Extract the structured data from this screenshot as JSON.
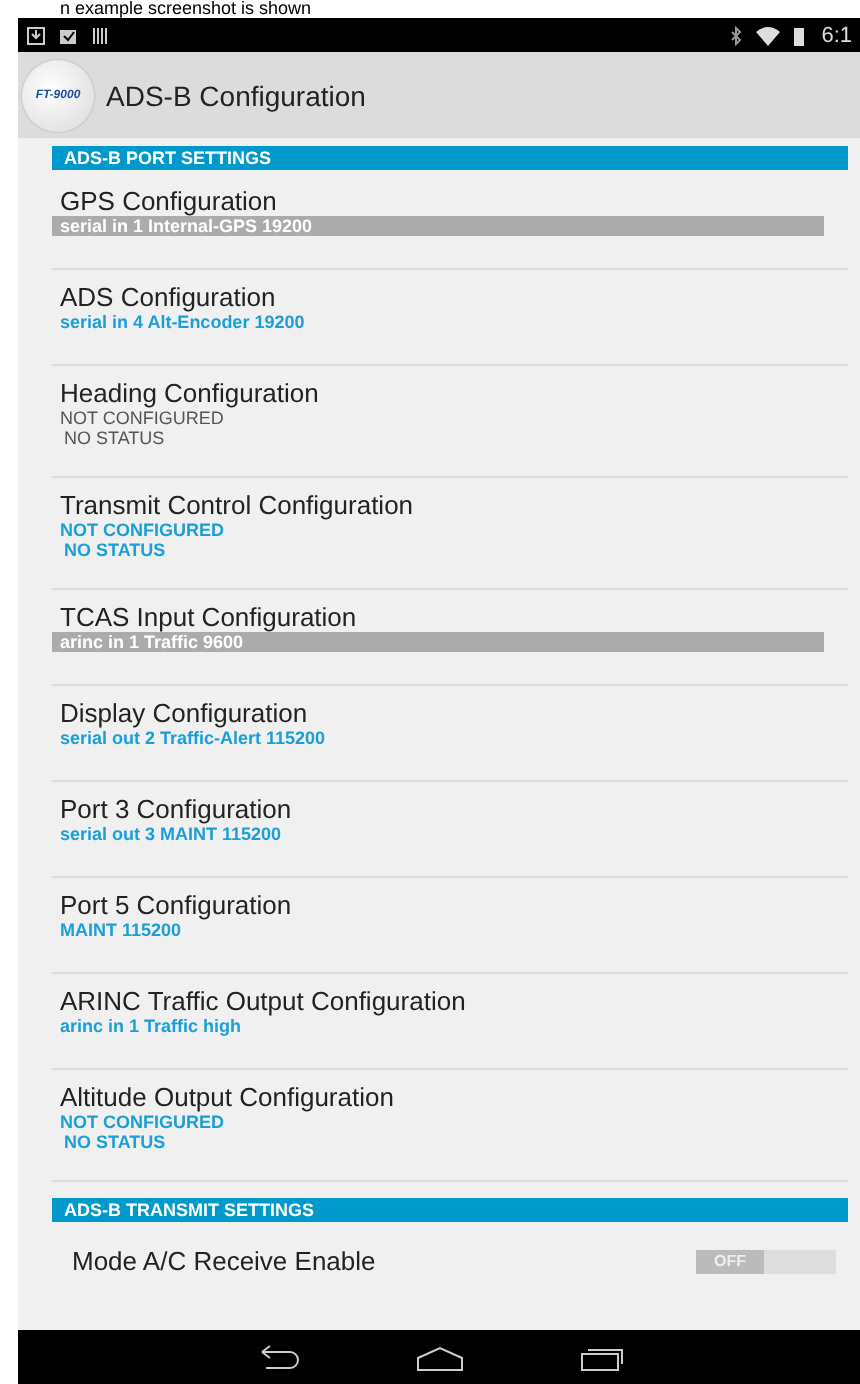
{
  "document_text": "n example screenshot is shown",
  "status_bar": {
    "time": "6:1"
  },
  "action_bar": {
    "title": "ADS-B Configuration",
    "logo_text": "FT-9000"
  },
  "sections": [
    {
      "header": "ADS-B PORT SETTINGS",
      "items": [
        {
          "kind": "config",
          "title": "GPS Configuration",
          "highlighted": true,
          "bold": true,
          "lines": [
            "serial in 1 Internal-GPS 19200"
          ]
        },
        {
          "kind": "config",
          "title": "ADS Configuration",
          "highlighted": false,
          "bold": true,
          "color": "#1a9fd8",
          "lines": [
            "serial in 4 Alt-Encoder 19200"
          ]
        },
        {
          "kind": "config",
          "title": "Heading Configuration",
          "highlighted": false,
          "bold": false,
          "color": "#555555",
          "lines": [
            "NOT CONFIGURED",
            "NO STATUS"
          ]
        },
        {
          "kind": "config",
          "title": "Transmit Control Configuration",
          "highlighted": false,
          "bold": true,
          "color": "#1a9fd8",
          "lines": [
            "NOT CONFIGURED",
            "NO STATUS"
          ]
        },
        {
          "kind": "config",
          "title": "TCAS Input Configuration",
          "highlighted": true,
          "bold": true,
          "lines": [
            "arinc in 1 Traffic 9600"
          ]
        },
        {
          "kind": "config",
          "title": "Display Configuration",
          "highlighted": false,
          "bold": true,
          "color": "#1a9fd8",
          "lines": [
            "serial out 2 Traffic-Alert 115200"
          ]
        },
        {
          "kind": "config",
          "title": "Port 3 Configuration",
          "highlighted": false,
          "bold": true,
          "color": "#1a9fd8",
          "lines": [
            "serial out 3 MAINT 115200"
          ]
        },
        {
          "kind": "config",
          "title": "Port 5 Configuration",
          "highlighted": false,
          "bold": true,
          "color": "#1a9fd8",
          "lines": [
            " MAINT 115200"
          ]
        },
        {
          "kind": "config",
          "title": "ARINC Traffic Output Configuration",
          "highlighted": false,
          "bold": true,
          "color": "#1a9fd8",
          "lines": [
            "arinc in 1 Traffic high"
          ]
        },
        {
          "kind": "config",
          "title": "Altitude Output Configuration",
          "highlighted": false,
          "bold": true,
          "color": "#1a9fd8",
          "lines": [
            "NOT CONFIGURED",
            "NO STATUS"
          ]
        }
      ]
    },
    {
      "header": "ADS-B TRANSMIT SETTINGS",
      "items": [
        {
          "kind": "switch",
          "title": "Mode A/C Receive Enable",
          "on": false,
          "switch_text": "OFF"
        }
      ]
    }
  ]
}
